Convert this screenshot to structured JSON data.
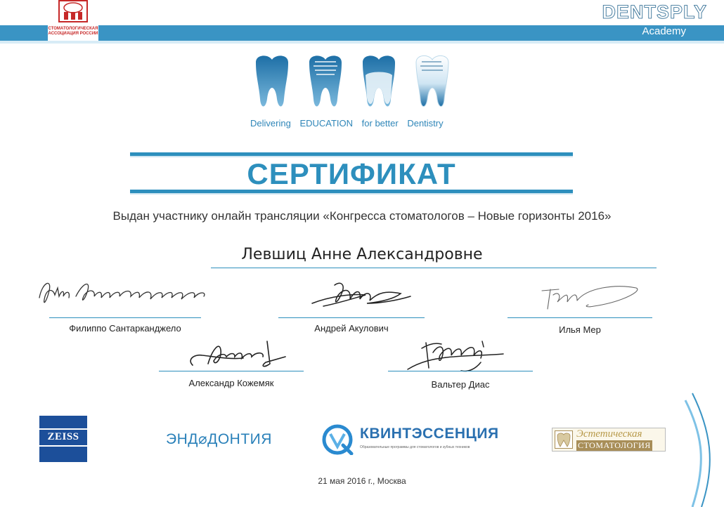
{
  "header": {
    "association_name": "СТОМАТОЛОГИЧЕСКАЯ АССОЦИАЦИЯ РОССИИ",
    "dentsply_name": "DENTSPLY",
    "dentsply_sub": "Academy"
  },
  "slogan": {
    "word1": "Delivering",
    "word2": "EDUCATION",
    "word3": "for better",
    "word4": "Dentistry"
  },
  "certificate": {
    "title": "СЕРТИФИКАТ",
    "issued_text": "Выдан участнику онлайн трансляции «Конгресса стоматологов – Новые горизонты 2016»",
    "recipient": "Левшиц Анне Александровне"
  },
  "signatories": [
    {
      "name": "Филиппо Сантарканджело"
    },
    {
      "name": "Андрей Акулович"
    },
    {
      "name": "Илья Мер"
    },
    {
      "name": "Александр Кожемяк"
    },
    {
      "name": "Вальтер Диас"
    }
  ],
  "sponsors": {
    "zeiss": "ZEISS",
    "endo": "ЭНД⌀ДОНТИЯ",
    "quint": "КВИНТЭССЕНЦИЯ",
    "quint_sub": "Образовательные программы для стоматологов и зубных техников",
    "estet_top": "Эстетическая",
    "estet_bot": "СТОМАТОЛОГИЯ"
  },
  "footer": {
    "date_place": "21 мая 2016 г., Москва"
  },
  "colors": {
    "brand_blue": "#2d8fbd",
    "band_blue": "#3a94c4",
    "association_red": "#c62828"
  }
}
